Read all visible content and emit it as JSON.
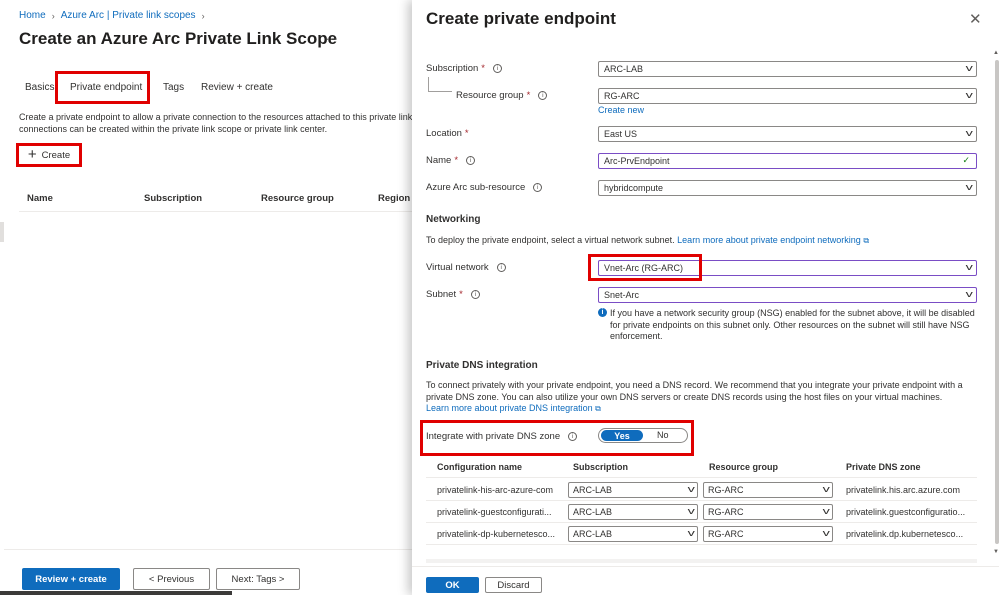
{
  "breadcrumb": [
    "Home",
    "Azure Arc | Private link scopes"
  ],
  "page_title": "Create an Azure Arc Private Link Scope",
  "page_more": "···",
  "tabs": [
    "Basics",
    "Private endpoint",
    "Tags",
    "Review + create"
  ],
  "description": {
    "line1": "Create a private endpoint to allow a private connection to the resources attached to this private link",
    "line2": "connections can be created within the private link scope or private link center."
  },
  "create_label": "Create",
  "table_columns": [
    "Name",
    "Subscription",
    "Resource group",
    "Region"
  ],
  "footer_buttons": {
    "review": "Review + create",
    "previous": "< Previous",
    "next": "Next: Tags >"
  },
  "panel": {
    "title": "Create private endpoint",
    "close": "✕",
    "fields": {
      "subscription": {
        "label": "Subscription",
        "value": "ARC-LAB"
      },
      "resource_group": {
        "label": "Resource group",
        "value": "RG-ARC",
        "create_new": "Create new"
      },
      "location": {
        "label": "Location",
        "value": "East US"
      },
      "name": {
        "label": "Name",
        "value": "Arc-PrvEndpoint"
      },
      "sub_resource": {
        "label": "Azure Arc sub-resource",
        "value": "hybridcompute"
      }
    },
    "networking": {
      "heading": "Networking",
      "desc": "To deploy the private endpoint, select a virtual network subnet.",
      "learn_more": "Learn more about private endpoint networking",
      "vnet": {
        "label": "Virtual network",
        "value": "Vnet-Arc (RG-ARC)"
      },
      "subnet": {
        "label": "Subnet",
        "value": "Snet-Arc"
      },
      "nsg_note": {
        "line1": "If you have a network security group (NSG) enabled for the subnet above, it will be disabled",
        "line2": "for private endpoints on this subnet only. Other resources on the subnet will still have NSG",
        "line3": "enforcement."
      }
    },
    "dns": {
      "heading": "Private DNS integration",
      "desc1": "To connect privately with your private endpoint, you need a DNS record. We recommend that you integrate your private endpoint with a",
      "desc2": "private DNS zone. You can also utilize your own DNS servers or create DNS records using the host files on your virtual machines.",
      "learn_more": "Learn more about private DNS integration",
      "integrate": {
        "label": "Integrate with private DNS zone",
        "yes": "Yes",
        "no": "No",
        "selected": "Yes"
      },
      "columns": [
        "Configuration name",
        "Subscription",
        "Resource group",
        "Private DNS zone"
      ],
      "rows": [
        {
          "config": "privatelink-his-arc-azure-com",
          "subscription": "ARC-LAB",
          "resource_group": "RG-ARC",
          "zone": "privatelink.his.arc.azure.com"
        },
        {
          "config": "privatelink-guestconfigurati...",
          "subscription": "ARC-LAB",
          "resource_group": "RG-ARC",
          "zone": "privatelink.guestconfiguratio..."
        },
        {
          "config": "privatelink-dp-kubernetesco...",
          "subscription": "ARC-LAB",
          "resource_group": "RG-ARC",
          "zone": "privatelink.dp.kubernetesco..."
        }
      ]
    },
    "buttons": {
      "ok": "OK",
      "discard": "Discard"
    }
  },
  "colors": {
    "accent": "#0f6cbd",
    "highlight": "#e00000",
    "required": "#a4262c",
    "valid": "#107c10",
    "focus_border": "#7a4dc5"
  }
}
